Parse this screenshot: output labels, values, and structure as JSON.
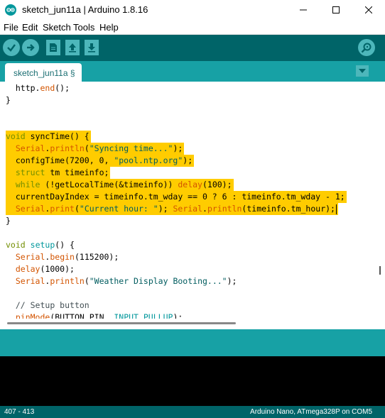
{
  "window": {
    "title": "sketch_jun11a | Arduino 1.8.16",
    "minimize_icon": "minimize-icon",
    "maximize_icon": "maximize-icon",
    "close_icon": "close-icon"
  },
  "menu": [
    "File",
    "Edit",
    "Sketch",
    "Tools",
    "Help"
  ],
  "toolbar": {
    "buttons": [
      "verify-icon",
      "upload-icon",
      "new-icon",
      "open-icon",
      "save-icon"
    ],
    "serial_monitor": "serial-monitor-icon"
  },
  "tab": {
    "label": "sketch_jun11a §"
  },
  "code_lines": [
    {
      "segments": [
        {
          "t": "  http.",
          "c": ""
        },
        {
          "t": "end",
          "c": "fn"
        },
        {
          "t": "();",
          "c": ""
        }
      ],
      "hl": false
    },
    {
      "segments": [
        {
          "t": "}",
          "c": ""
        }
      ],
      "hl": false
    },
    {
      "segments": [
        {
          "t": "",
          "c": ""
        }
      ],
      "hl": false
    },
    {
      "segments": [
        {
          "t": "",
          "c": ""
        }
      ],
      "hl": false
    },
    {
      "segments": [
        {
          "t": "void",
          "c": "kw"
        },
        {
          "t": " syncTime() {",
          "c": ""
        }
      ],
      "hl": true
    },
    {
      "segments": [
        {
          "t": "  ",
          "c": ""
        },
        {
          "t": "Serial",
          "c": "fn"
        },
        {
          "t": ".",
          "c": ""
        },
        {
          "t": "println",
          "c": "fn"
        },
        {
          "t": "(",
          "c": ""
        },
        {
          "t": "\"Syncing time...\"",
          "c": "str"
        },
        {
          "t": ");",
          "c": ""
        }
      ],
      "hl": true
    },
    {
      "segments": [
        {
          "t": "  configTime(7200, 0, ",
          "c": ""
        },
        {
          "t": "\"pool.ntp.org\"",
          "c": "str"
        },
        {
          "t": ");",
          "c": ""
        }
      ],
      "hl": true
    },
    {
      "segments": [
        {
          "t": "  ",
          "c": ""
        },
        {
          "t": "struct",
          "c": "kw"
        },
        {
          "t": " tm timeinfo;",
          "c": ""
        }
      ],
      "hl": true
    },
    {
      "segments": [
        {
          "t": "  ",
          "c": ""
        },
        {
          "t": "while",
          "c": "kw"
        },
        {
          "t": " (!getLocalTime(&timeinfo)) ",
          "c": ""
        },
        {
          "t": "delay",
          "c": "fn"
        },
        {
          "t": "(100);",
          "c": ""
        }
      ],
      "hl": true
    },
    {
      "segments": [
        {
          "t": "  currentDayIndex = timeinfo.tm_wday == 0 ? 6 : timeinfo.tm_wday - 1;",
          "c": ""
        }
      ],
      "hl": true
    },
    {
      "segments": [
        {
          "t": "  ",
          "c": ""
        },
        {
          "t": "Serial",
          "c": "fn"
        },
        {
          "t": ".",
          "c": ""
        },
        {
          "t": "print",
          "c": "fn"
        },
        {
          "t": "(",
          "c": ""
        },
        {
          "t": "\"Current hour: \"",
          "c": "str"
        },
        {
          "t": "); ",
          "c": ""
        },
        {
          "t": "Serial",
          "c": "fn"
        },
        {
          "t": ".",
          "c": ""
        },
        {
          "t": "println",
          "c": "fn"
        },
        {
          "t": "(timeinfo.tm_hour);",
          "c": ""
        }
      ],
      "hl": true,
      "cursor": true
    },
    {
      "segments": [
        {
          "t": "}",
          "c": ""
        }
      ],
      "hl": false
    },
    {
      "segments": [
        {
          "t": "",
          "c": ""
        }
      ],
      "hl": false
    },
    {
      "segments": [
        {
          "t": "void",
          "c": "kw"
        },
        {
          "t": " ",
          "c": ""
        },
        {
          "t": "setup",
          "c": "kw2"
        },
        {
          "t": "() {",
          "c": ""
        }
      ],
      "hl": false
    },
    {
      "segments": [
        {
          "t": "  ",
          "c": ""
        },
        {
          "t": "Serial",
          "c": "fn"
        },
        {
          "t": ".",
          "c": ""
        },
        {
          "t": "begin",
          "c": "fn"
        },
        {
          "t": "(115200);",
          "c": ""
        }
      ],
      "hl": false
    },
    {
      "segments": [
        {
          "t": "  ",
          "c": ""
        },
        {
          "t": "delay",
          "c": "fn"
        },
        {
          "t": "(1000);",
          "c": ""
        }
      ],
      "hl": false
    },
    {
      "segments": [
        {
          "t": "  ",
          "c": ""
        },
        {
          "t": "Serial",
          "c": "fn"
        },
        {
          "t": ".",
          "c": ""
        },
        {
          "t": "println",
          "c": "fn"
        },
        {
          "t": "(",
          "c": ""
        },
        {
          "t": "\"Weather Display Booting...\"",
          "c": "str"
        },
        {
          "t": ");",
          "c": ""
        }
      ],
      "hl": false
    },
    {
      "segments": [
        {
          "t": "",
          "c": ""
        }
      ],
      "hl": false
    },
    {
      "segments": [
        {
          "t": "  ",
          "c": ""
        },
        {
          "t": "// Setup button",
          "c": "cm"
        }
      ],
      "hl": false
    },
    {
      "segments": [
        {
          "t": "  ",
          "c": ""
        },
        {
          "t": "pinMode",
          "c": "fn"
        },
        {
          "t": "(BUTTON_PIN, ",
          "c": ""
        },
        {
          "t": "INPUT_PULLUP",
          "c": "kw2"
        },
        {
          "t": ");",
          "c": ""
        }
      ],
      "hl": false
    }
  ],
  "status": {
    "line_range": "407 - 413",
    "board": "Arduino Nano, ATmega328P on COM5"
  },
  "colors": {
    "toolbar": "#006468",
    "tabbar": "#17a1a5",
    "button": "#4db7bb",
    "highlight": "#ffcc00"
  }
}
